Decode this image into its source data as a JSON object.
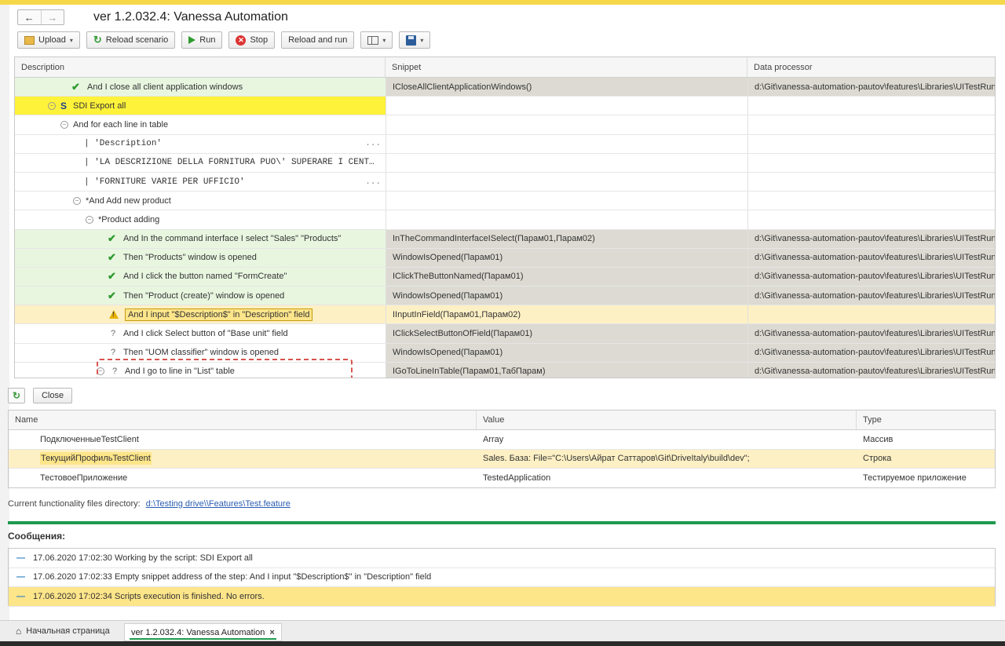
{
  "title": "ver 1.2.032.4: Vanessa Automation",
  "nav": {
    "back": "←",
    "forward": "→"
  },
  "toolbar": {
    "upload": "Upload",
    "reload_scenario": "Reload scenario",
    "run": "Run",
    "stop": "Stop",
    "reload_and_run": "Reload and run"
  },
  "steps_grid": {
    "columns": [
      "Description",
      "Snippet",
      "Data processor"
    ],
    "rows": [
      {
        "status": "ok",
        "text": "And I close all client application windows",
        "snippet": "ICloseAllClientApplicationWindows()",
        "processor": "d:\\Git\\vanessa-automation-pautov\\features\\Libraries\\UITestRunner"
      },
      {
        "status": "scenario",
        "badge": "S",
        "text": "SDI Export all",
        "snippet": "",
        "processor": ""
      },
      {
        "status": "group",
        "text": "And for each line in table",
        "snippet": "",
        "processor": ""
      },
      {
        "status": "table",
        "text": "| 'Description'",
        "ellipsis": "...",
        "snippet": "",
        "processor": ""
      },
      {
        "status": "table",
        "text": "| 'LA DESCRIZIONE DELLA FORNITURA PUO\\' SUPERARE I CENT…",
        "ellipsis": "",
        "snippet": "",
        "processor": ""
      },
      {
        "status": "table",
        "text": "| 'FORNITURE VARIE PER UFFICIO'",
        "ellipsis": "...",
        "snippet": "",
        "processor": ""
      },
      {
        "status": "group",
        "text": "*And Add new product",
        "snippet": "",
        "processor": ""
      },
      {
        "status": "group",
        "text": "*Product adding",
        "snippet": "",
        "processor": ""
      },
      {
        "status": "ok",
        "text": "And In the command interface I select \"Sales\" \"Products\"",
        "snippet": "InTheCommandInterfaceISelect(Парам01,Парам02)",
        "processor": "d:\\Git\\vanessa-automation-pautov\\features\\Libraries\\UITestRunner"
      },
      {
        "status": "ok",
        "text": "Then \"Products\" window is opened",
        "snippet": "WindowIsOpened(Парам01)",
        "processor": "d:\\Git\\vanessa-automation-pautov\\features\\Libraries\\UITestRunner"
      },
      {
        "status": "ok",
        "text": "And I click the button named \"FormCreate\"",
        "snippet": "IClickTheButtonNamed(Парам01)",
        "processor": "d:\\Git\\vanessa-automation-pautov\\features\\Libraries\\UITestRunner"
      },
      {
        "status": "ok",
        "text": "Then \"Product (create)\" window is opened",
        "snippet": "WindowIsOpened(Парам01)",
        "processor": "d:\\Git\\vanessa-automation-pautov\\features\\Libraries\\UITestRunner"
      },
      {
        "status": "warning",
        "text": "And I input \"$Description$\" in \"Description\" field",
        "snippet": "IInputInField(Парам01,Парам02)",
        "processor": ""
      },
      {
        "status": "pending",
        "text": "And I click Select button of \"Base unit\" field",
        "snippet": "IClickSelectButtonOfField(Парам01)",
        "processor": "d:\\Git\\vanessa-automation-pautov\\features\\Libraries\\UITestRunner"
      },
      {
        "status": "pending",
        "text": "Then \"UOM classifier\" window is opened",
        "snippet": "WindowIsOpened(Парам01)",
        "processor": "d:\\Git\\vanessa-automation-pautov\\features\\Libraries\\UITestRunner"
      },
      {
        "status": "pending",
        "text": "And I go to line in \"List\" table",
        "snippet": "IGoToLineInTable(Парам01,ТабПарам)",
        "processor": "d:\\Git\\vanessa-automation-pautov\\features\\Libraries\\UITestRunner"
      }
    ]
  },
  "vars_panel": {
    "close": "Close",
    "columns": [
      "Name",
      "Value",
      "Type"
    ],
    "rows": [
      {
        "name": "ПодключенныеTestClient",
        "value": "Array",
        "type": "Массив"
      },
      {
        "name": "ТекущийПрофильTestClient",
        "value": "Sales. База: File=\"C:\\Users\\Айрат Саттаров\\Git\\DriveItaly\\build\\dev\";",
        "type": "Строка"
      },
      {
        "name": "ТестовоеПриложение",
        "value": "TestedApplication",
        "type": "Тестируемое приложение"
      }
    ]
  },
  "dir": {
    "label": "Current functionality files directory:",
    "link": "d:\\Testing drive\\\\Features\\Test.feature"
  },
  "messages": {
    "title": "Сообщения:",
    "items": [
      "17.06.2020 17:02:30 Working by the script: SDI Export all",
      "17.06.2020 17:02:33 Empty snippet address of the step: And I input \"$Description$\" in \"Description\" field",
      "17.06.2020 17:02:34 Scripts execution is finished. No errors."
    ]
  },
  "bottom": {
    "home": "Начальная страница",
    "tab": "ver 1.2.032.4: Vanessa Automation",
    "tab_close": "×"
  }
}
